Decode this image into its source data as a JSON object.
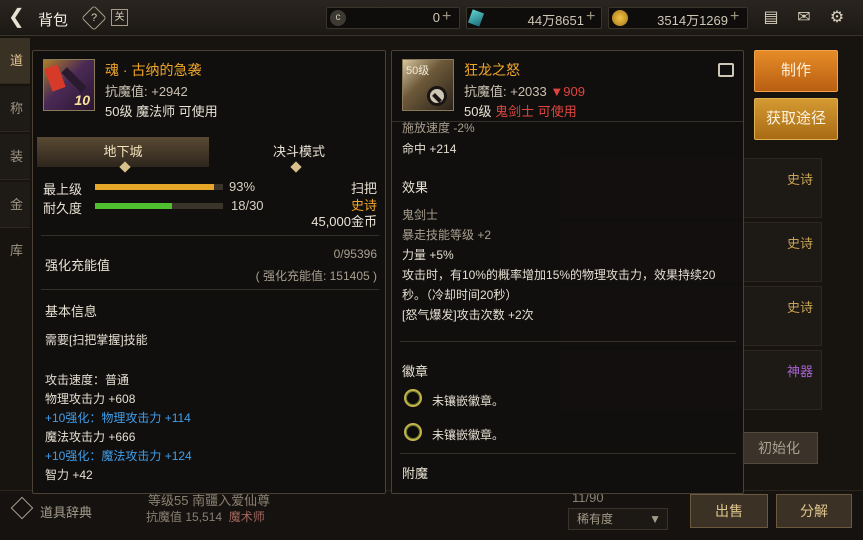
{
  "topbar": {
    "back_icon": "back-arrow-icon",
    "title": "背包",
    "help": "?",
    "sort": "关",
    "currency": [
      {
        "icon": "c",
        "value": "0",
        "plus": "+"
      },
      {
        "icon": "gem",
        "value": "44万8651",
        "plus": "+"
      },
      {
        "icon": "coin",
        "value": "3514万1269",
        "plus": "+"
      }
    ]
  },
  "background": {
    "side_tabs": [
      "道具",
      "称号",
      "装扮",
      "金库"
    ],
    "grid_labels": [
      "史诗",
      "史诗",
      "史诗",
      "神器"
    ],
    "init_button": "初始化",
    "dict_label": "道具辞典",
    "level_line": "等级55 南疆入爱仙尊",
    "res_line": "抗魔值 15,514",
    "class_name": "魔术师",
    "count": "11/90",
    "rarity": "稀有度",
    "sell": "出售",
    "decompose": "分解"
  },
  "left_item": {
    "name": "魂 · 古纳的急袭",
    "resist": "抗魔值: +2942",
    "requirement": "50级 魔法师 可使用",
    "icon_level": "10",
    "tabs": [
      "地下城",
      "决斗模式"
    ],
    "stats": [
      {
        "label": "最上级",
        "value": "93%",
        "fraction": 0.93,
        "color": "#e6a628"
      },
      {
        "label": "耐久度",
        "value": "18/30",
        "fraction": 0.6,
        "color": "#4fbf2f"
      }
    ],
    "sweep": "扫把",
    "rarity": "史诗",
    "price": "45,000金币",
    "charge_label": "强化充能值",
    "charge_value": "0/95396",
    "charge_sub": "( 强化充能值: 151405 )",
    "basic_info_title": "基本信息",
    "lines": [
      {
        "text": "需要[扫把掌握]技能",
        "style": "normal"
      },
      {
        "text": "攻击速度：普通",
        "style": "normal"
      },
      {
        "text": "物理攻击力 +608",
        "style": "normal"
      },
      {
        "text": "+10强化：物理攻击力 +114",
        "style": "blue"
      },
      {
        "text": "魔法攻击力 +666",
        "style": "normal"
      },
      {
        "text": "+10强化：魔法攻击力 +124",
        "style": "blue"
      },
      {
        "text": "智力 +42",
        "style": "normal"
      }
    ]
  },
  "right_item": {
    "icon_level": "50级",
    "name": "狂龙之怒",
    "resist": "抗魔值: +2033",
    "resist_diff": "▼909",
    "req_level": "50级",
    "req_class": "鬼剑士 可使用",
    "lines_top": [
      {
        "text": "施放速度 -2%",
        "style": "dim"
      },
      {
        "text": "命中 +214",
        "style": "normal"
      }
    ],
    "effect_title": "效果",
    "effect_lines": [
      {
        "text": "鬼剑士",
        "style": "dim"
      },
      {
        "text": "暴走技能等级 +2",
        "style": "dim"
      },
      {
        "text": "力量 +5%",
        "style": "normal"
      },
      {
        "text": "攻击时，有10%的概率增加15%的物理攻击力，效果持续20",
        "style": "normal"
      },
      {
        "text": "秒。（冷却时间20秒）",
        "style": "normal"
      },
      {
        "text": "[怒气爆发]攻击次数 +2次",
        "style": "normal"
      }
    ],
    "emblem_title": "徽章",
    "emblems": [
      "未镶嵌徽章。",
      "未镶嵌徽章。"
    ],
    "enchant_title": "附魔"
  },
  "actions": {
    "craft": "制作",
    "acquire": "获取途径"
  }
}
